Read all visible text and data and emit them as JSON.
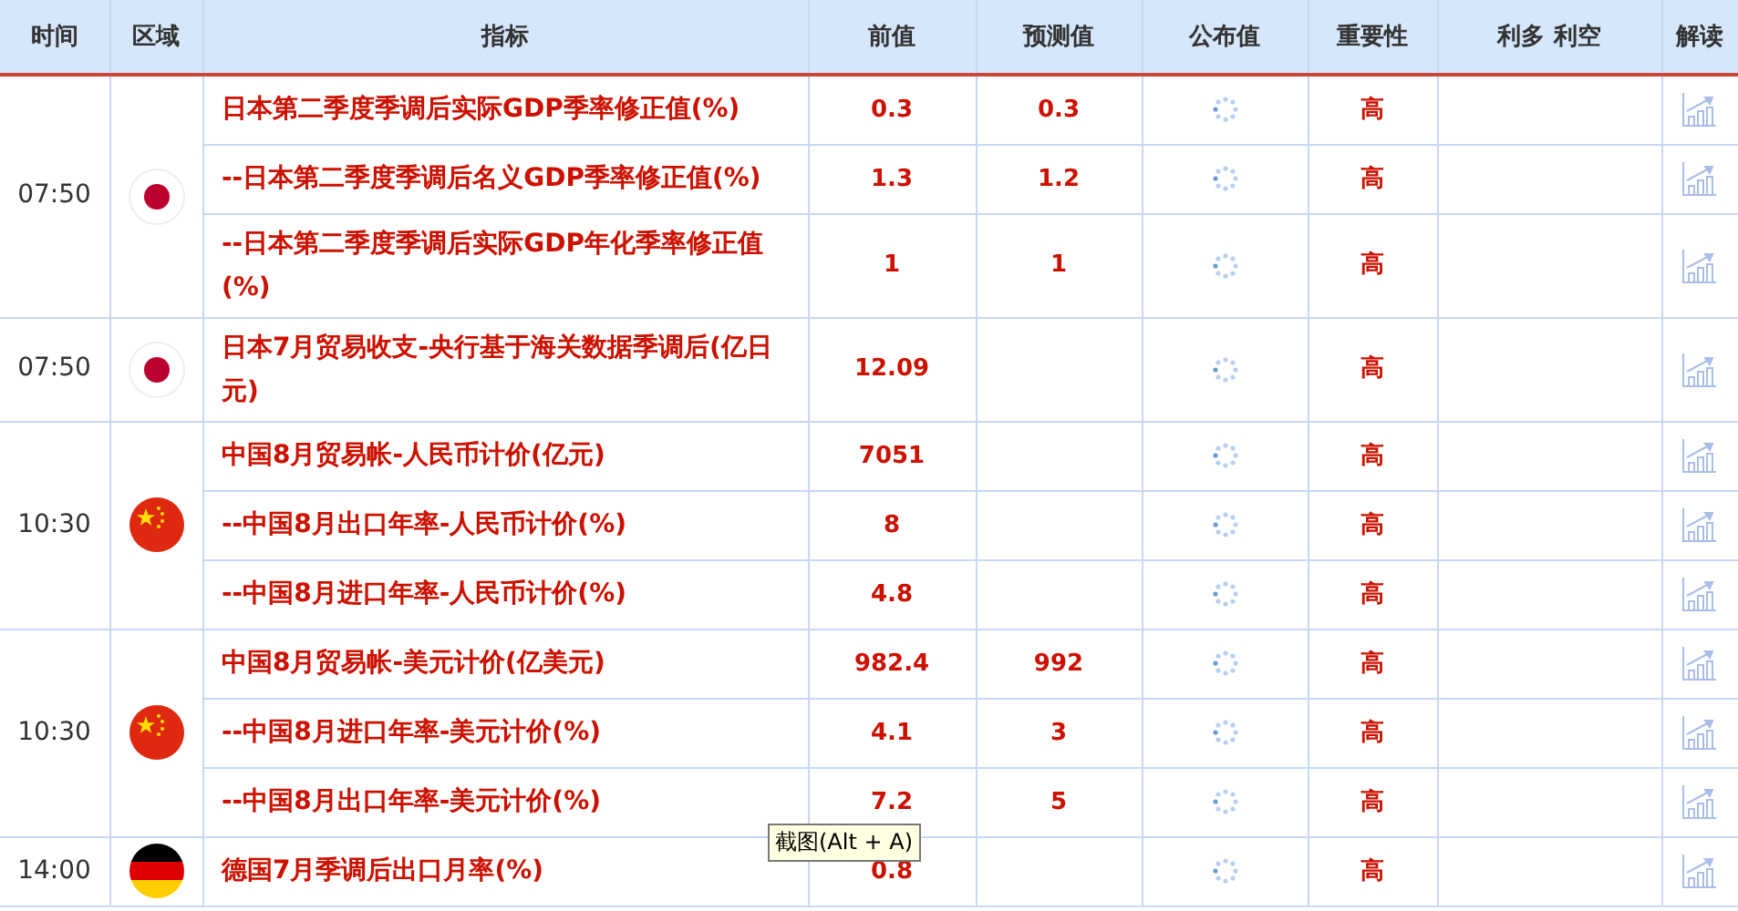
{
  "columns": [
    "时间",
    "区域",
    "指标",
    "前值",
    "预测值",
    "公布值",
    "重要性",
    "利多 利空",
    "解读"
  ],
  "groups": [
    {
      "time": "07:50",
      "kind": "japan",
      "rows": [
        {
          "indicator": "日本第二季度季调后实际GDP季率修正值(%)",
          "previous": "0.3",
          "forecast": "0.3",
          "importance": "高"
        },
        {
          "indicator": "--日本第二季度季调后名义GDP季率修正值(%)",
          "previous": "1.3",
          "forecast": "1.2",
          "importance": "高"
        },
        {
          "indicator": "--日本第二季度季调后实际GDP年化季率修正值(%)",
          "previous": "1",
          "forecast": "1",
          "importance": "高"
        }
      ]
    },
    {
      "time": "07:50",
      "kind": "japan",
      "rows": [
        {
          "indicator": "日本7月贸易收支-央行基于海关数据季调后(亿日元)",
          "previous": "12.09",
          "importance": "高"
        }
      ]
    },
    {
      "time": "10:30",
      "kind": "china",
      "rows": [
        {
          "indicator": "中国8月贸易帐-人民币计价(亿元)",
          "previous": "7051",
          "importance": "高"
        },
        {
          "indicator": "--中国8月出口年率-人民币计价(%)",
          "previous": "8",
          "importance": "高"
        },
        {
          "indicator": "--中国8月进口年率-人民币计价(%)",
          "previous": "4.8",
          "importance": "高"
        }
      ]
    },
    {
      "time": "10:30",
      "kind": "china",
      "rows": [
        {
          "indicator": "中国8月贸易帐-美元计价(亿美元)",
          "previous": "982.4",
          "forecast": "992",
          "importance": "高"
        },
        {
          "indicator": "--中国8月进口年率-美元计价(%)",
          "previous": "4.1",
          "forecast": "3",
          "importance": "高"
        },
        {
          "indicator": "--中国8月出口年率-美元计价(%)",
          "previous": "7.2",
          "forecast": "5",
          "importance": "高"
        }
      ]
    },
    {
      "time": "14:00",
      "kind": "germany",
      "rows": [
        {
          "indicator": "德国7月季调后出口月率(%)",
          "previous": "0.8",
          "importance": "高"
        }
      ]
    }
  ],
  "tooltip": {
    "text": "截图(Alt + A)"
  }
}
